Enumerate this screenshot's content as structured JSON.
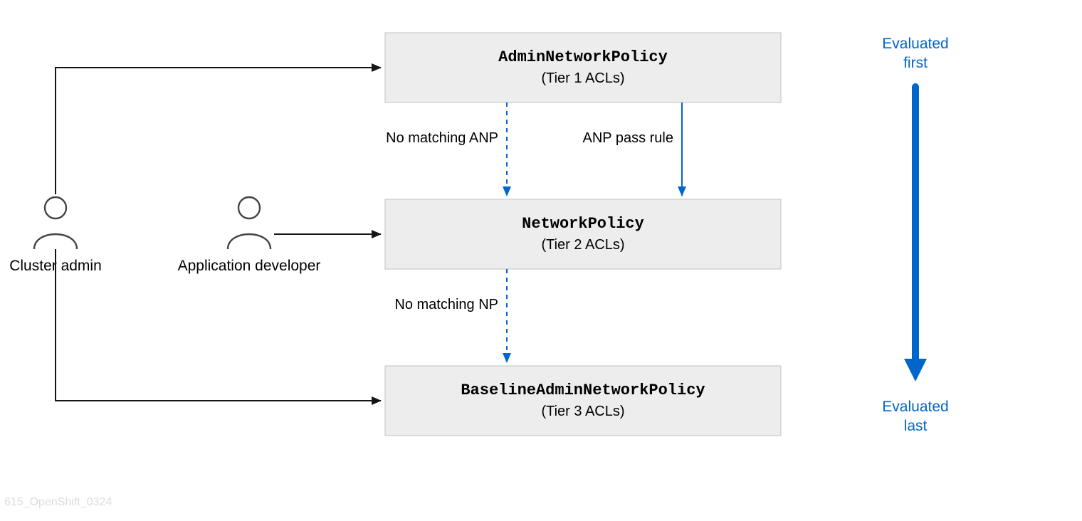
{
  "boxes": {
    "anp": {
      "title": "AdminNetworkPolicy",
      "subtitle": "(Tier 1 ACLs)"
    },
    "np": {
      "title": "NetworkPolicy",
      "subtitle": "(Tier 2 ACLs)"
    },
    "banp": {
      "title": "BaselineAdminNetworkPolicy",
      "subtitle": "(Tier 3 ACLs)"
    }
  },
  "roles": {
    "cluster_admin": "Cluster admin",
    "app_dev": "Application developer"
  },
  "flows": {
    "no_anp": "No matching ANP",
    "anp_pass": "ANP pass rule",
    "no_np": "No matching NP"
  },
  "evaluation": {
    "first_l1": "Evaluated",
    "first_l2": "first",
    "last_l1": "Evaluated",
    "last_l2": "last"
  },
  "watermark": "615_OpenShift_0324"
}
